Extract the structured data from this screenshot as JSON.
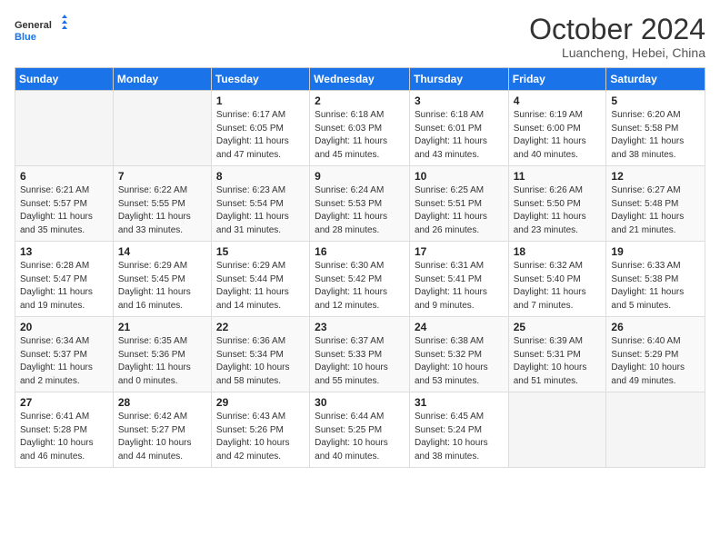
{
  "header": {
    "logo_line1": "General",
    "logo_line2": "Blue",
    "month": "October 2024",
    "location": "Luancheng, Hebei, China"
  },
  "weekdays": [
    "Sunday",
    "Monday",
    "Tuesday",
    "Wednesday",
    "Thursday",
    "Friday",
    "Saturday"
  ],
  "weeks": [
    [
      null,
      null,
      {
        "day": 1,
        "sunrise": "6:17 AM",
        "sunset": "6:05 PM",
        "daylight": "11 hours and 47 minutes."
      },
      {
        "day": 2,
        "sunrise": "6:18 AM",
        "sunset": "6:03 PM",
        "daylight": "11 hours and 45 minutes."
      },
      {
        "day": 3,
        "sunrise": "6:18 AM",
        "sunset": "6:01 PM",
        "daylight": "11 hours and 43 minutes."
      },
      {
        "day": 4,
        "sunrise": "6:19 AM",
        "sunset": "6:00 PM",
        "daylight": "11 hours and 40 minutes."
      },
      {
        "day": 5,
        "sunrise": "6:20 AM",
        "sunset": "5:58 PM",
        "daylight": "11 hours and 38 minutes."
      }
    ],
    [
      {
        "day": 6,
        "sunrise": "6:21 AM",
        "sunset": "5:57 PM",
        "daylight": "11 hours and 35 minutes."
      },
      {
        "day": 7,
        "sunrise": "6:22 AM",
        "sunset": "5:55 PM",
        "daylight": "11 hours and 33 minutes."
      },
      {
        "day": 8,
        "sunrise": "6:23 AM",
        "sunset": "5:54 PM",
        "daylight": "11 hours and 31 minutes."
      },
      {
        "day": 9,
        "sunrise": "6:24 AM",
        "sunset": "5:53 PM",
        "daylight": "11 hours and 28 minutes."
      },
      {
        "day": 10,
        "sunrise": "6:25 AM",
        "sunset": "5:51 PM",
        "daylight": "11 hours and 26 minutes."
      },
      {
        "day": 11,
        "sunrise": "6:26 AM",
        "sunset": "5:50 PM",
        "daylight": "11 hours and 23 minutes."
      },
      {
        "day": 12,
        "sunrise": "6:27 AM",
        "sunset": "5:48 PM",
        "daylight": "11 hours and 21 minutes."
      }
    ],
    [
      {
        "day": 13,
        "sunrise": "6:28 AM",
        "sunset": "5:47 PM",
        "daylight": "11 hours and 19 minutes."
      },
      {
        "day": 14,
        "sunrise": "6:29 AM",
        "sunset": "5:45 PM",
        "daylight": "11 hours and 16 minutes."
      },
      {
        "day": 15,
        "sunrise": "6:29 AM",
        "sunset": "5:44 PM",
        "daylight": "11 hours and 14 minutes."
      },
      {
        "day": 16,
        "sunrise": "6:30 AM",
        "sunset": "5:42 PM",
        "daylight": "11 hours and 12 minutes."
      },
      {
        "day": 17,
        "sunrise": "6:31 AM",
        "sunset": "5:41 PM",
        "daylight": "11 hours and 9 minutes."
      },
      {
        "day": 18,
        "sunrise": "6:32 AM",
        "sunset": "5:40 PM",
        "daylight": "11 hours and 7 minutes."
      },
      {
        "day": 19,
        "sunrise": "6:33 AM",
        "sunset": "5:38 PM",
        "daylight": "11 hours and 5 minutes."
      }
    ],
    [
      {
        "day": 20,
        "sunrise": "6:34 AM",
        "sunset": "5:37 PM",
        "daylight": "11 hours and 2 minutes."
      },
      {
        "day": 21,
        "sunrise": "6:35 AM",
        "sunset": "5:36 PM",
        "daylight": "11 hours and 0 minutes."
      },
      {
        "day": 22,
        "sunrise": "6:36 AM",
        "sunset": "5:34 PM",
        "daylight": "10 hours and 58 minutes."
      },
      {
        "day": 23,
        "sunrise": "6:37 AM",
        "sunset": "5:33 PM",
        "daylight": "10 hours and 55 minutes."
      },
      {
        "day": 24,
        "sunrise": "6:38 AM",
        "sunset": "5:32 PM",
        "daylight": "10 hours and 53 minutes."
      },
      {
        "day": 25,
        "sunrise": "6:39 AM",
        "sunset": "5:31 PM",
        "daylight": "10 hours and 51 minutes."
      },
      {
        "day": 26,
        "sunrise": "6:40 AM",
        "sunset": "5:29 PM",
        "daylight": "10 hours and 49 minutes."
      }
    ],
    [
      {
        "day": 27,
        "sunrise": "6:41 AM",
        "sunset": "5:28 PM",
        "daylight": "10 hours and 46 minutes."
      },
      {
        "day": 28,
        "sunrise": "6:42 AM",
        "sunset": "5:27 PM",
        "daylight": "10 hours and 44 minutes."
      },
      {
        "day": 29,
        "sunrise": "6:43 AM",
        "sunset": "5:26 PM",
        "daylight": "10 hours and 42 minutes."
      },
      {
        "day": 30,
        "sunrise": "6:44 AM",
        "sunset": "5:25 PM",
        "daylight": "10 hours and 40 minutes."
      },
      {
        "day": 31,
        "sunrise": "6:45 AM",
        "sunset": "5:24 PM",
        "daylight": "10 hours and 38 minutes."
      },
      null,
      null
    ]
  ]
}
